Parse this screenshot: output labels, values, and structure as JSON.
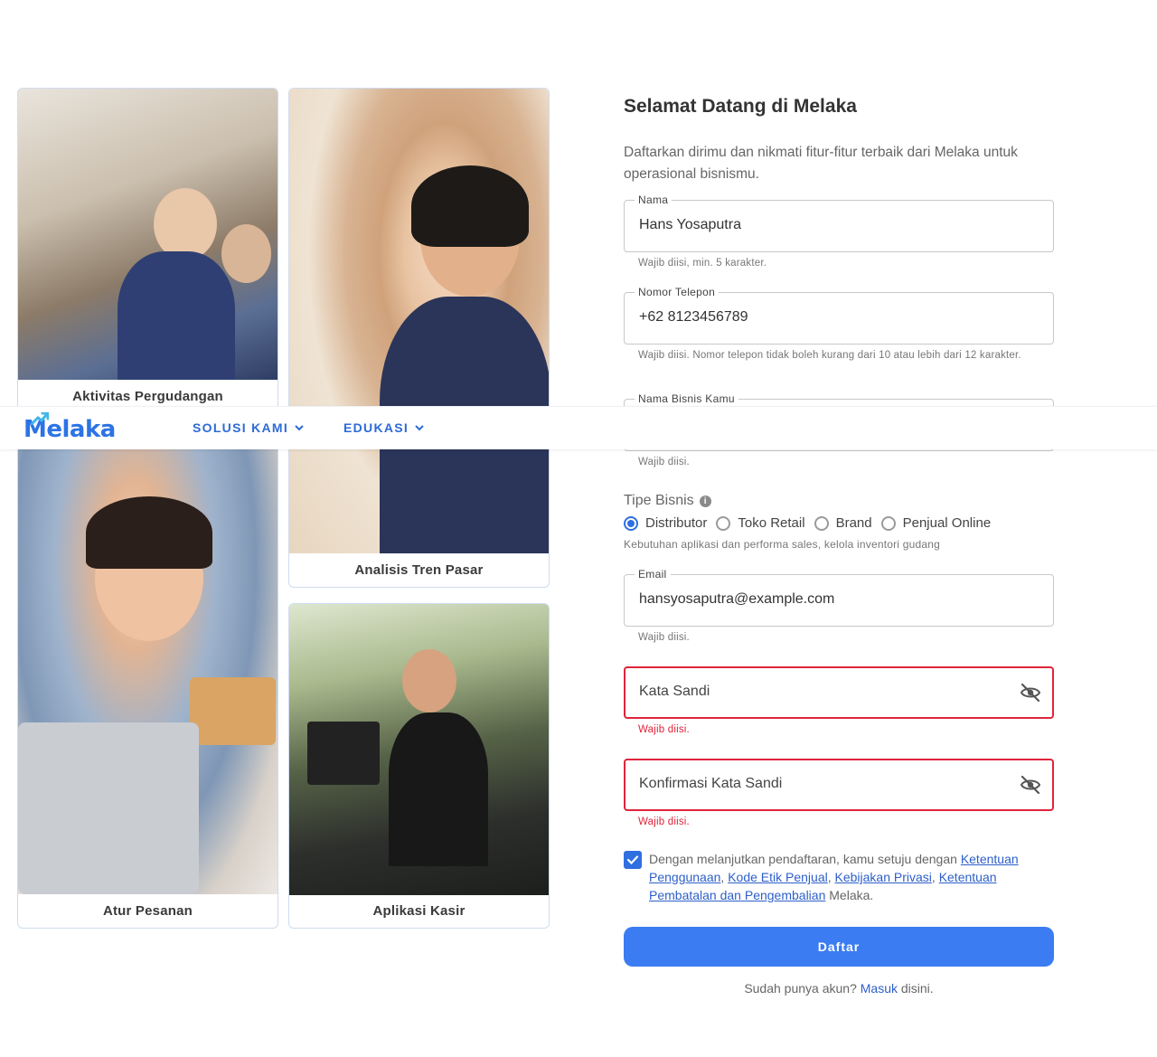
{
  "nav": {
    "logo": "Melaka",
    "items": [
      {
        "label": "SOLUSI KAMI"
      },
      {
        "label": "EDUKASI"
      }
    ]
  },
  "cards": [
    {
      "caption": "Aktivitas Pergudangan"
    },
    {
      "caption": "Analisis Tren Pasar"
    },
    {
      "caption": "Atur Pesanan"
    },
    {
      "caption": "Aplikasi Kasir"
    }
  ],
  "form": {
    "title": "Selamat Datang di Melaka",
    "subtitle": "Daftarkan dirimu dan nikmati fitur-fitur terbaik dari Melaka untuk operasional bisnismu.",
    "nama": {
      "label": "Nama",
      "value": "Hans Yosaputra",
      "hint": "Wajib diisi, min. 5 karakter."
    },
    "telepon": {
      "label": "Nomor Telepon",
      "value": "+62 8123456789",
      "hint": "Wajib diisi. Nomor telepon tidak boleh kurang dari 10 atau lebih dari 12 karakter."
    },
    "bisnis": {
      "label": "Nama Bisnis Kamu",
      "value": "",
      "hint": "Wajib diisi."
    },
    "tipe_bisnis": {
      "label": "Tipe Bisnis",
      "info_glyph": "i",
      "options": [
        "Distributor",
        "Toko Retail",
        "Brand",
        "Penjual Online"
      ],
      "selected": "Distributor",
      "description": "Kebutuhan aplikasi dan performa sales, kelola inventori gudang"
    },
    "email": {
      "label": "Email",
      "value": "hansyosaputra@example.com",
      "hint": "Wajib diisi."
    },
    "password": {
      "placeholder": "Kata Sandi",
      "error": "Wajib diisi.",
      "icon": "eye-off-icon"
    },
    "confirm_password": {
      "placeholder": "Konfirmasi Kata Sandi",
      "error": "Wajib diisi.",
      "icon": "eye-off-icon"
    },
    "agreement": {
      "checked": true,
      "prefix": "Dengan melanjutkan pendaftaran, kamu setuju dengan ",
      "links": [
        "Ketentuan Penggunaan",
        "Kode Etik Penjual",
        "Kebijakan Privasi",
        "Ketentuan Pembatalan dan Pengembalian"
      ],
      "sep": ", ",
      "suffix": " Melaka."
    },
    "submit_label": "Daftar",
    "login_prefix": "Sudah punya akun? ",
    "login_link": "Masuk",
    "login_suffix": " disini."
  },
  "colors": {
    "accent": "#3b7cf2",
    "error": "#e0243a",
    "link": "#2d5fc9",
    "logo": "#2c73e6"
  }
}
